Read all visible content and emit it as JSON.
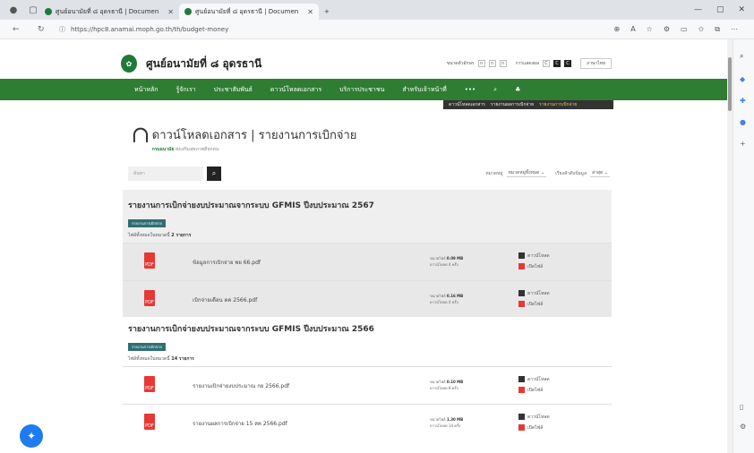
{
  "browser": {
    "tabs": [
      {
        "label": "ศูนย์อนามัยที่ ๘ อุดรธานี | Documen"
      },
      {
        "label": "ศูนย์อนามัยที่ ๘ อุดรธานี | Documen"
      }
    ],
    "new_tab": "+",
    "url": "https://hpc8.anamai.moph.go.th/th/budget-money",
    "window_controls": [
      "—",
      "▢",
      "✕"
    ]
  },
  "site": {
    "title": "ศูนย์อนามัยที่ ๘ อุดรธานี",
    "font_size_label": "ขนาดตัวอักษร",
    "font_buttons": [
      "ก",
      "ก",
      "ก"
    ],
    "contrast_label": "การแสดงผล",
    "contrast_buttons": [
      "C",
      "C",
      "C"
    ],
    "language": "ภาษาไทย"
  },
  "nav": {
    "items": [
      "หน้าหลัก",
      "รู้จักเรา",
      "ประชาสัมพันธ์",
      "ดาวน์โหลดเอกสาร",
      "บริการประชาชน",
      "สำหรับเจ้าหน้าที่",
      "•••"
    ]
  },
  "breadcrumb": [
    "ดาวน์โหลดเอกสาร",
    "รายงานผลการเบิกจ่าย",
    "รายงานการเบิกจ่าย"
  ],
  "page": {
    "title_main": "ดาวน์โหลดเอกสาร | รายงานการเบิกจ่าย",
    "subtitle_org": "กรมอนามัย",
    "subtitle": "ส่งเสริมสุขภาพดีทุกคน"
  },
  "search": {
    "placeholder": "ค้นหา",
    "category_label": "หมวดหมู่",
    "category_value": "หมวดหมู่ทั้งหมด",
    "sort_label": "เรียงลำดับข้อมูล",
    "sort_value": "ล่าสุด"
  },
  "sections": [
    {
      "title": "รายงานการเบิกจ่ายงบประมาณจากระบบ GFMIS ปีงบประมาณ 2567",
      "tag": "รายงานการเบิกจ่าย",
      "count_prefix": "ไฟล์ทั้งหมดในหมวดนี้",
      "count_value": "2 รายการ",
      "files": [
        {
          "name": "ข้อมูลการเบิกจ่าย พย 66.pdf",
          "size_label": "ขนาดไฟล์",
          "size": "0.09 MB",
          "downloads": "ดาวน์โหลด 4 ครั้ง",
          "dl": "ดาวน์โหลด",
          "view": "เปิดไฟล์"
        },
        {
          "name": "เบิกจ่ายเดือน ตค 2566.pdf",
          "size_label": "ขนาดไฟล์",
          "size": "0.16 MB",
          "downloads": "ดาวน์โหลด 4 ครั้ง",
          "dl": "ดาวน์โหลด",
          "view": "เปิดไฟล์"
        }
      ]
    },
    {
      "title": "รายงานการเบิกจ่ายงบประมาณจากระบบ GFMIS ปีงบประมาณ 2566",
      "tag": "รายงานการเบิกจ่าย",
      "count_prefix": "ไฟล์ทั้งหมดในหมวดนี้",
      "count_value": "14 รายการ",
      "files": [
        {
          "name": "รายงานเบิกจ่ายงบประมาณ กย 2566.pdf",
          "size_label": "ขนาดไฟล์",
          "size": "0.10 MB",
          "downloads": "ดาวน์โหลด 8 ครั้ง",
          "dl": "ดาวน์โหลด",
          "view": "เปิดไฟล์"
        },
        {
          "name": "รายงานผลการเบิกจ่าย 15 สค 2566.pdf",
          "size_label": "ขนาดไฟล์",
          "size": "1.30 MB",
          "downloads": "ดาวน์โหลด 14 ครั้ง",
          "dl": "ดาวน์โหลด",
          "view": "เปิดไฟล์"
        }
      ]
    }
  ]
}
